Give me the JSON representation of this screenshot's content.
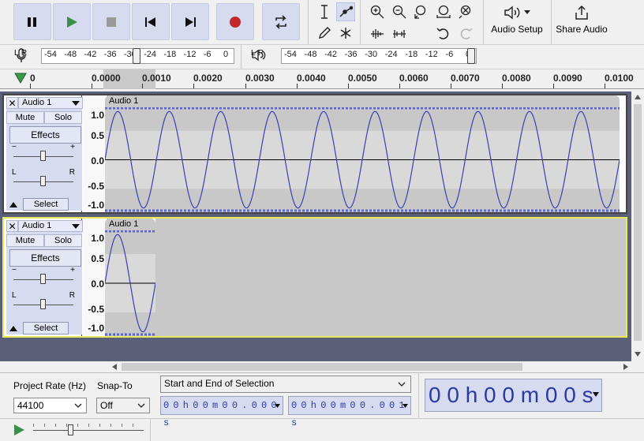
{
  "toolbar": {
    "transport": [
      "pause",
      "play",
      "stop",
      "skip-start",
      "skip-end",
      "record",
      "loop"
    ],
    "audio_setup_label": "Audio Setup",
    "share_audio_label": "Share Audio"
  },
  "meters": {
    "record": {
      "l": "L",
      "r": "R",
      "ticks": [
        "-54",
        "-48",
        "-42",
        "-36",
        "-30",
        "-24",
        "-18",
        "-12",
        "-6",
        "0"
      ]
    },
    "playback": {
      "l": "L",
      "r": "R",
      "ticks": [
        "-54",
        "-48",
        "-42",
        "-36",
        "-30",
        "-24",
        "-18",
        "-12",
        "-6",
        "0"
      ]
    }
  },
  "ruler": {
    "ticks": [
      "0",
      "0.0000",
      "0.0010",
      "0.0020",
      "0.0030",
      "0.0040",
      "0.0050",
      "0.0060",
      "0.0070",
      "0.0080",
      "0.0090",
      "0.0100"
    ]
  },
  "tracks": [
    {
      "name": "Audio 1",
      "clip_name": "Audio 1",
      "mute": "Mute",
      "solo": "Solo",
      "effects": "Effects",
      "select": "Select",
      "gain_minus": "−",
      "gain_plus": "+",
      "pan_l": "L",
      "pan_r": "R",
      "scale": [
        "1.0",
        "0.5",
        "0.0",
        "-0.5",
        "-1.0"
      ]
    },
    {
      "name": "Audio 1",
      "clip_name": "Audio 1",
      "mute": "Mute",
      "solo": "Solo",
      "effects": "Effects",
      "select": "Select",
      "gain_minus": "−",
      "gain_plus": "+",
      "pan_l": "L",
      "pan_r": "R",
      "scale": [
        "1.0",
        "0.5",
        "0.0",
        "-0.5",
        "-1.0"
      ]
    }
  ],
  "bottom": {
    "project_rate_label": "Project Rate (Hz)",
    "snap_to_label": "Snap-To",
    "project_rate_value": "44100",
    "snap_to_value": "Off",
    "selection_mode": "Start and End of Selection",
    "sel_start": "0 0 h 0 0 m 0 0 . 0 0 0 s",
    "sel_end": "0 0 h 0 0 m 0 0 . 0 0 1 s",
    "big_time": "0 0 h 0 0 m 0 0 s"
  }
}
